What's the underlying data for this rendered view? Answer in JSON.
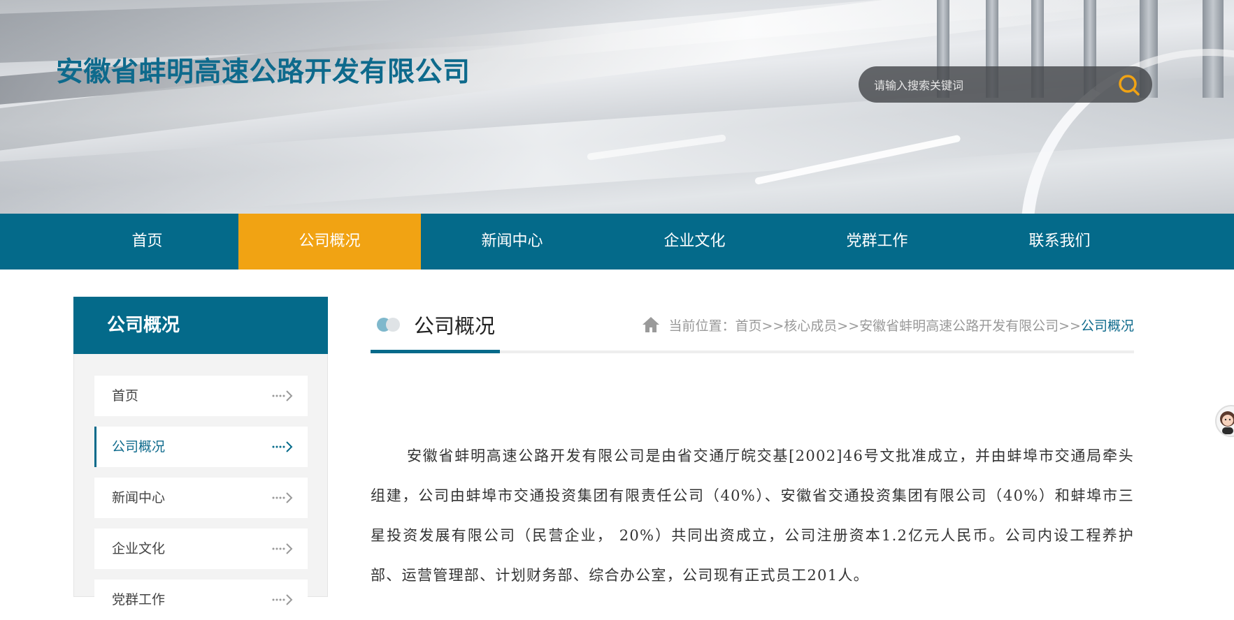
{
  "header": {
    "site_title": "安徽省蚌明高速公路开发有限公司",
    "search": {
      "placeholder": "请输入搜索关键词",
      "icon": "search-icon",
      "icon_color": "#f1a313"
    }
  },
  "nav": {
    "items": [
      {
        "label": "首页"
      },
      {
        "label": "公司概况",
        "active": true
      },
      {
        "label": "新闻中心"
      },
      {
        "label": "企业文化"
      },
      {
        "label": "党群工作"
      },
      {
        "label": "联系我们"
      }
    ],
    "color": "#046a8a",
    "active_color": "#f1a313"
  },
  "sidebar": {
    "title": "公司概况",
    "items": [
      {
        "label": "首页"
      },
      {
        "label": "公司概况",
        "active": true
      },
      {
        "label": "新闻中心"
      },
      {
        "label": "企业文化"
      },
      {
        "label": "党群工作"
      }
    ],
    "arrow_icon": "arrow-right-icon"
  },
  "content": {
    "title": "公司概况",
    "breadcrumb": {
      "home_icon": "home-icon",
      "prefix": "当前位置：",
      "path": "首页>>核心成员>>安徽省蚌明高速公路开发有限公司>>",
      "current": "公司概况"
    },
    "paragraph": "安徽省蚌明高速公路开发有限公司是由省交通厅皖交基[2002]46号文批准成立，并由蚌埠市交通局牵头组建，公司由蚌埠市交通投资集团有限责任公司（40%）、安徽省交通投资集团有限公司（40%）和蚌埠市三星投资发展有限公司（民营企业， 20%）共同出资成立，公司注册资本1.2亿元人民币。公司内设工程养护部、运营管理部、计划财务部、综合办公室，公司现有正式员工201人。"
  },
  "floating_widget": {
    "icon": "customer-service-avatar-icon"
  }
}
